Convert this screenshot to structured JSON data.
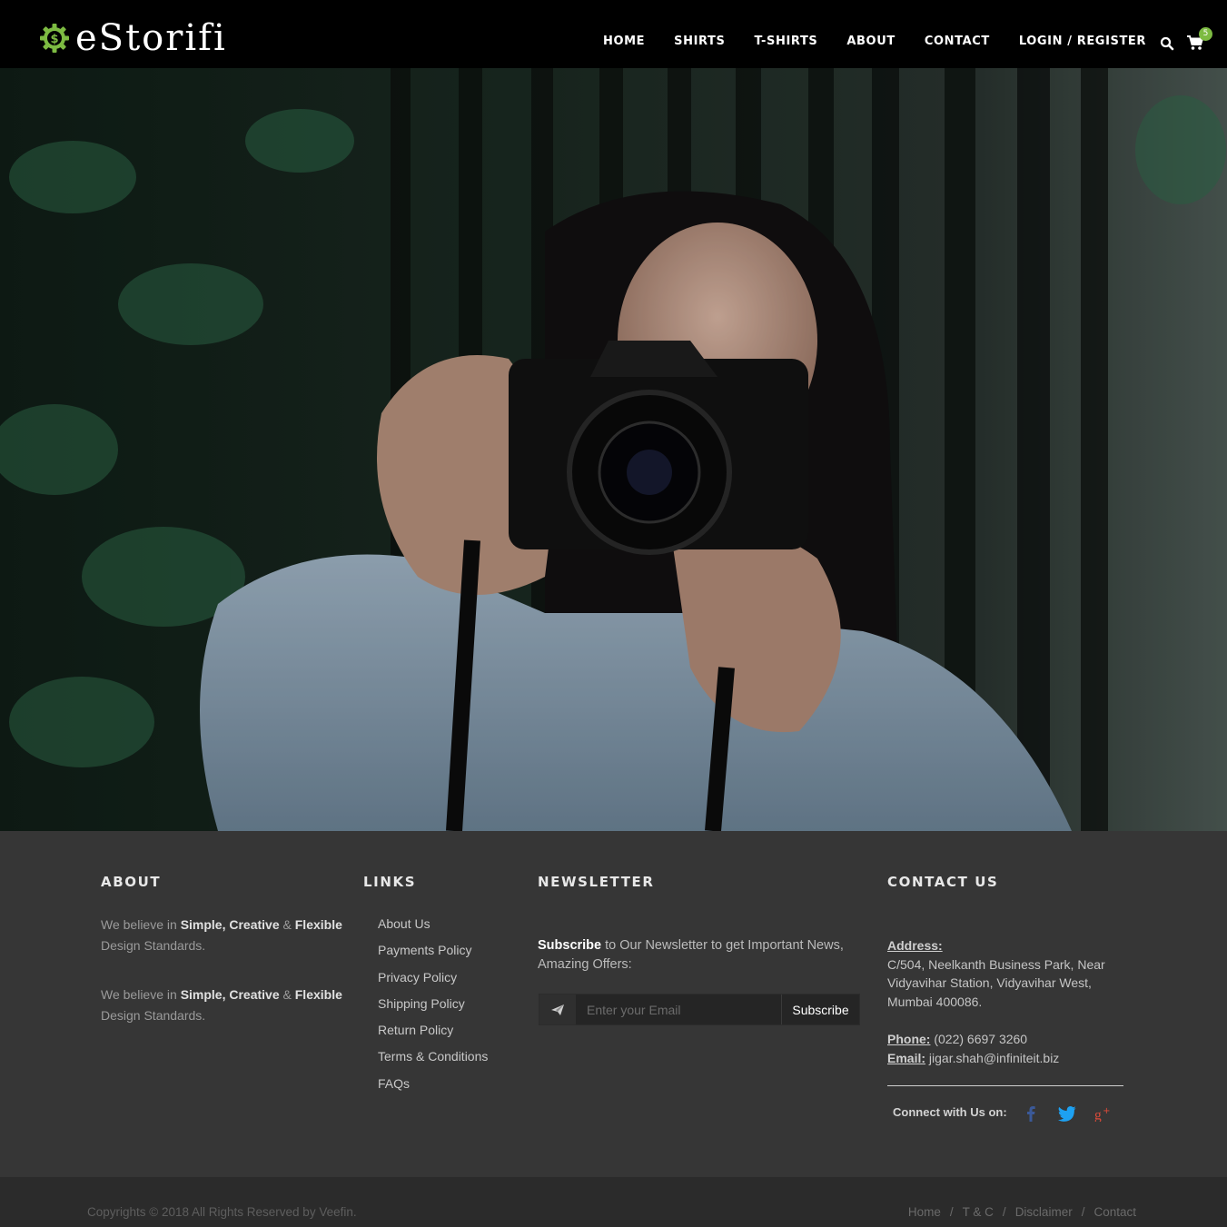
{
  "brand": {
    "name": "eStorifi",
    "logo_icon": "dollar-gear-icon"
  },
  "nav": {
    "items": [
      "HOME",
      "SHIRTS",
      "T-SHIRTS",
      "ABOUT",
      "CONTACT",
      "LOGIN / REGISTER"
    ],
    "search_icon": "search-icon",
    "cart_icon": "cart-icon",
    "cart_count": "5"
  },
  "hero": {
    "image": "woman-with-camera-photo"
  },
  "footer": {
    "about": {
      "title": "ABOUT",
      "paragraphs": [
        {
          "prefix": "We believe in ",
          "b1": "Simple, Creative",
          "amp": " & ",
          "b2": "Flexible",
          "suffix": " Design Standards."
        },
        {
          "prefix": "We believe in ",
          "b1": "Simple, Creative",
          "amp": " & ",
          "b2": "Flexible",
          "suffix": " Design Standards."
        }
      ]
    },
    "links": {
      "title": "LINKS",
      "items": [
        "About Us",
        "Payments Policy",
        "Privacy Policy",
        "Shipping Policy",
        "Return Policy",
        "Terms & Conditions",
        "FAQs"
      ]
    },
    "newsletter": {
      "title": "NEWSLETTER",
      "text_bold": "Subscribe",
      "text_rest": " to Our Newsletter to get Important News, Amazing Offers:",
      "placeholder": "Enter your Email",
      "button": "Subscribe",
      "send_icon": "paper-plane-icon"
    },
    "contact": {
      "title": "CONTACT US",
      "address_label": "Address:",
      "address": "C/504, Neelkanth Business Park, Near Vidyavihar Station, Vidyavihar West, Mumbai 400086.",
      "phone_label": "Phone:",
      "phone": " (022) 6697 3260",
      "email_label": "Email:",
      "email": " jigar.shah@infiniteit.biz",
      "connect_label": "Connect with Us on:",
      "social": [
        {
          "name": "facebook-icon",
          "glyph": "f",
          "color": "#3b5998"
        },
        {
          "name": "twitter-icon",
          "glyph": "t",
          "color": "#1da1f2"
        },
        {
          "name": "google-plus-icon",
          "glyph": "g+",
          "color": "#dd4b39"
        }
      ]
    }
  },
  "bottom": {
    "copyright": "Copyrights © 2018 All Rights Reserved by Veefin.",
    "links": [
      "Home",
      "T & C",
      "Disclaimer",
      "Contact"
    ]
  },
  "colors": {
    "accent": "#7dbb42",
    "header_bg": "#000000",
    "footer_bg": "#363636",
    "bottom_bg": "#2b2b2b"
  }
}
